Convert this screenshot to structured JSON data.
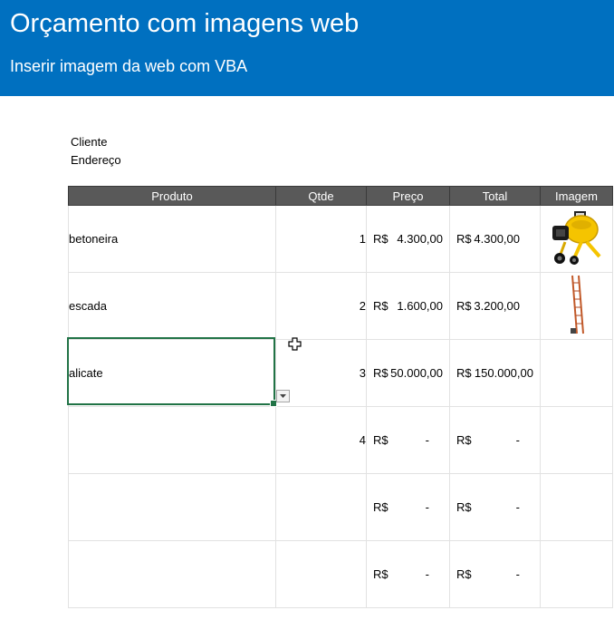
{
  "header": {
    "title": "Orçamento com imagens web",
    "subtitle": "Inserir imagem da web com VBA"
  },
  "info": {
    "cliente_label": "Cliente",
    "endereco_label": "Endereço"
  },
  "table": {
    "columns": [
      "Produto",
      "Qtde",
      "Preço",
      "Total",
      "Imagem"
    ],
    "rows": [
      {
        "produto": "betoneira",
        "qtde": "1",
        "preco_sym": "R$",
        "preco": "4.300,00",
        "total_sym": "R$",
        "total": "4.300,00",
        "imagem": "concrete-mixer-image"
      },
      {
        "produto": "escada",
        "qtde": "2",
        "preco_sym": "R$",
        "preco": "1.600,00",
        "total_sym": "R$",
        "total": "3.200,00",
        "imagem": "ladder-image"
      },
      {
        "produto": "alicate",
        "qtde": "3",
        "preco_sym": "R$",
        "preco": "50.000,00",
        "total_sym": "R$",
        "total": "150.000,00",
        "imagem": ""
      },
      {
        "produto": "",
        "qtde": "4",
        "preco_sym": "R$",
        "preco": "-",
        "total_sym": "R$",
        "total": "-",
        "imagem": ""
      },
      {
        "produto": "",
        "qtde": "",
        "preco_sym": "R$",
        "preco": "-",
        "total_sym": "R$",
        "total": "-",
        "imagem": ""
      },
      {
        "produto": "",
        "qtde": "",
        "preco_sym": "R$",
        "preco": "-",
        "total_sym": "R$",
        "total": "-",
        "imagem": ""
      }
    ]
  },
  "colors": {
    "header_bg": "#0070c0",
    "table_header_bg": "#595959",
    "selection": "#217346"
  }
}
